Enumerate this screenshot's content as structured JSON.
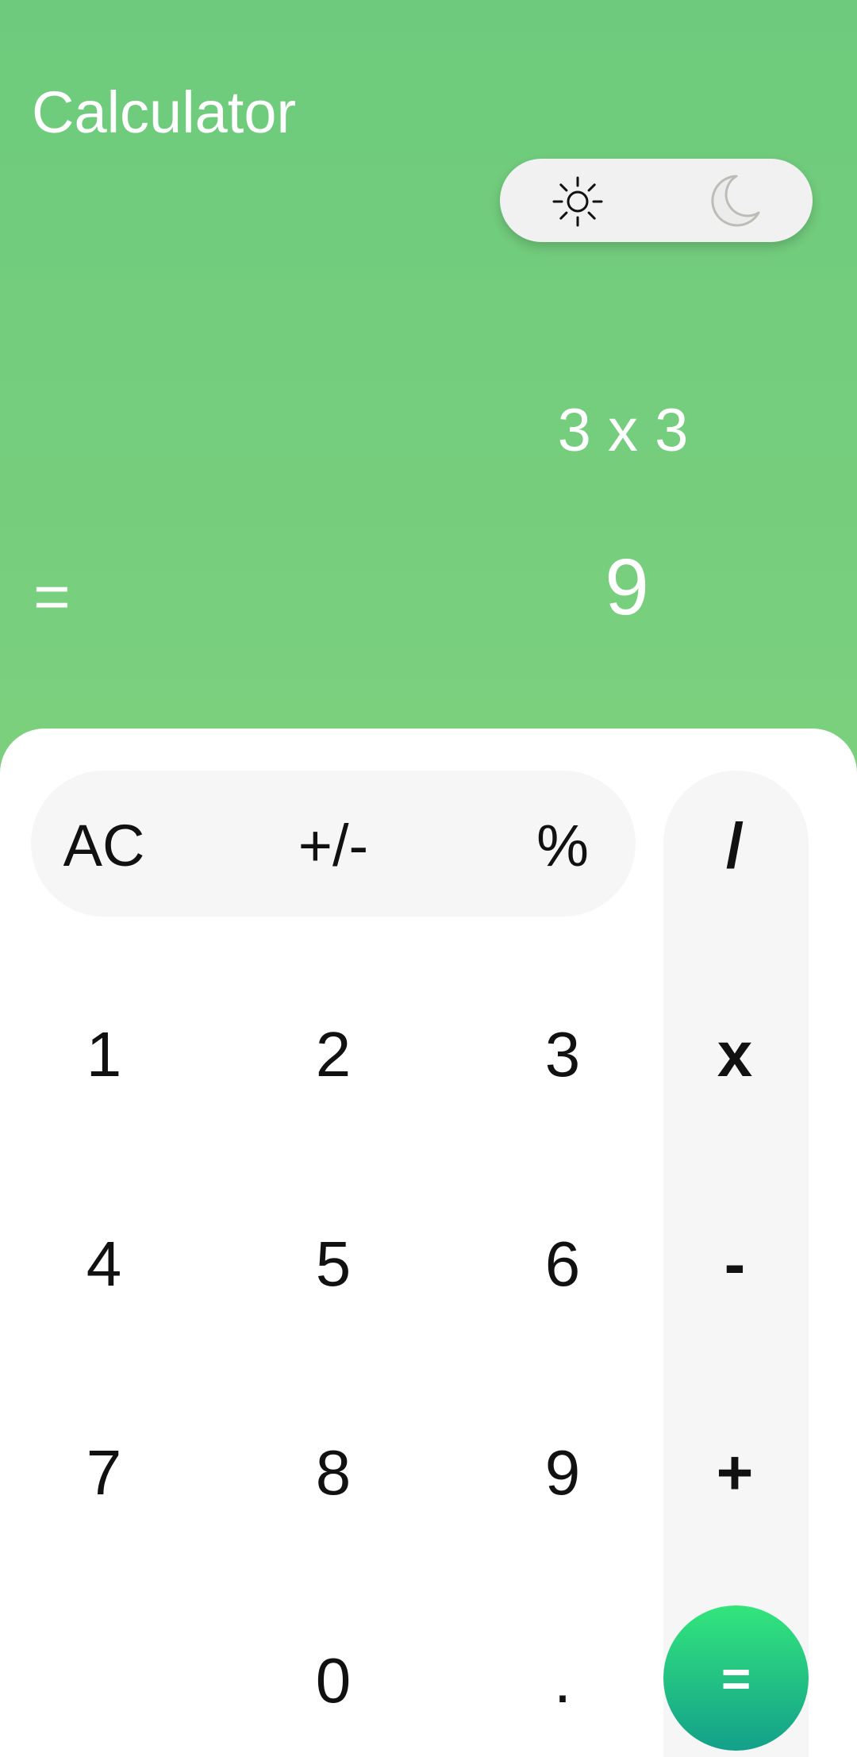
{
  "app": {
    "title": "Calculator"
  },
  "theme_toggle": {
    "light_icon": "sun-icon",
    "dark_icon": "moon-icon",
    "selected": "light"
  },
  "display": {
    "expression": "3 x 3",
    "equals_sign": "=",
    "result": "9"
  },
  "keys": {
    "ac": "AC",
    "plus_minus": "+/-",
    "percent": "%",
    "divide": "/",
    "multiply": "x",
    "subtract": "-",
    "add": "+",
    "equals": "=",
    "one": "1",
    "two": "2",
    "three": "3",
    "four": "4",
    "five": "5",
    "six": "6",
    "seven": "7",
    "eight": "8",
    "nine": "9",
    "zero": "0",
    "decimal": "."
  },
  "colors": {
    "header_background": "#72cc7d",
    "equals_gradient_top": "#33e57c",
    "equals_gradient_bottom": "#13a08a",
    "key_pill_background": "#f6f6f6"
  }
}
